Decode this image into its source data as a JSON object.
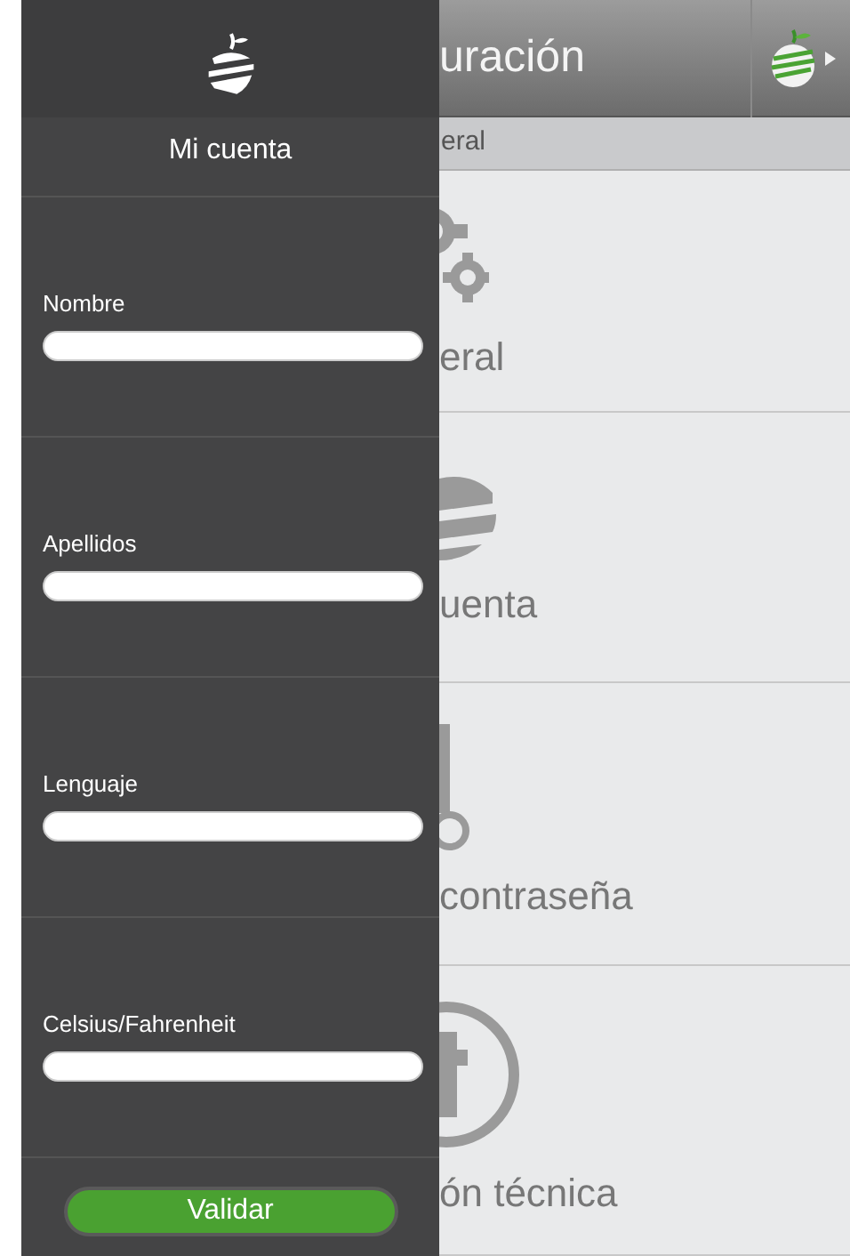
{
  "app": {
    "title": "uración",
    "subheader": "eral",
    "items": [
      {
        "kind": "gears",
        "label": "eral"
      },
      {
        "kind": "globe",
        "label": "uenta"
      },
      {
        "kind": "key",
        "label": "contraseña"
      },
      {
        "kind": "info",
        "label": "ón técnica"
      }
    ]
  },
  "panel": {
    "title": "Mi cuenta",
    "fields": [
      {
        "label": "Nombre"
      },
      {
        "label": "Apellidos"
      },
      {
        "label": "Lenguaje"
      },
      {
        "label": "Celsius/Fahrenheit"
      }
    ],
    "button": "Validar"
  }
}
